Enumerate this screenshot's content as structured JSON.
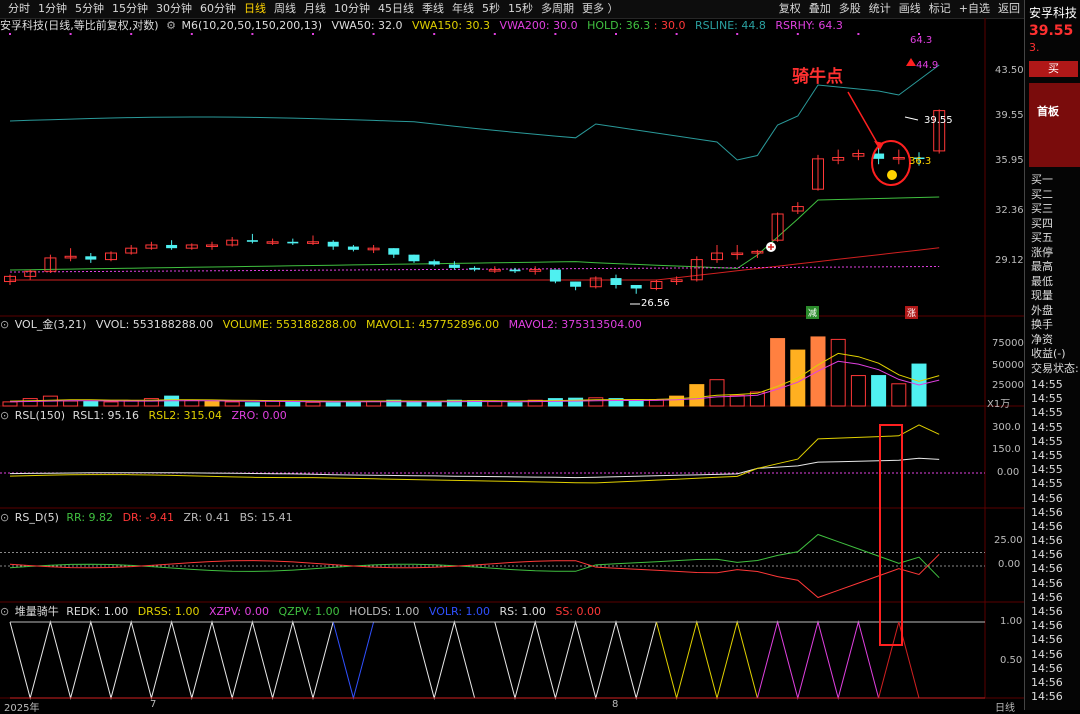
{
  "toolbar": {
    "periods": [
      "分时",
      "1分钟",
      "5分钟",
      "15分钟",
      "30分钟",
      "60分钟",
      "日线",
      "周线",
      "月线",
      "10分钟",
      "45日线",
      "季线",
      "年线",
      "5秒",
      "15秒",
      "多周期",
      "更多 ）"
    ],
    "active_period": "日线",
    "right": [
      "复权",
      "叠加",
      "多股",
      "统计",
      "画线",
      "标记",
      "+自选",
      "返回"
    ]
  },
  "main_title": {
    "stock": "安孚科技(日线,等比前复权,对数)",
    "indicator": "M6(10,20,50,150,200,13)",
    "vwa50": "VWA50: 32.0",
    "vwa150": "VWA150: 30.3",
    "vwa200": "VWA200: 30.0",
    "hold": "HOLD: 36.3",
    "hold2": ": 30.0",
    "rsline": "RSLINE: 44.8",
    "rsrhy": "RSRHY: 64.3"
  },
  "price_axis": [
    "43.50",
    "39.55",
    "35.95",
    "32.36",
    "29.12"
  ],
  "annotations": {
    "riding_bull": "骑牛点",
    "high_label": "39.55",
    "low_label": "26.56",
    "hold_label": "36.3",
    "rsrhy_label": "64.3",
    "rsline_label": "44.9",
    "jian": "减",
    "zhang": "涨"
  },
  "vol_title": {
    "name": "VOL_金(3,21)",
    "vvol": "VVOL: 553188288.00",
    "volume": "VOLUME: 553188288.00",
    "mavol1": "MAVOL1: 457752896.00",
    "mavol2": "MAVOL2: 375313504.00"
  },
  "vol_axis": [
    "75000",
    "50000",
    "25000"
  ],
  "vol_unit": "X1万",
  "rsl_title": {
    "name": "RSL(150)",
    "rsl1": "RSL1: 95.16",
    "rsl2": "RSL2: 315.04",
    "zro": "ZRO: 0.00"
  },
  "rsl_axis": [
    "300.0",
    "150.0",
    "0.00"
  ],
  "rsd_title": {
    "name": "RS_D(5)",
    "rr": "RR: 9.82",
    "dr": "DR: -9.41",
    "zr": "ZR: 0.41",
    "bs": "BS: 15.41"
  },
  "rsd_axis": [
    "25.00",
    "0.00"
  ],
  "bull_title": {
    "name": "堆量骑牛",
    "redk": "REDK: 1.00",
    "drss": "DRSS: 1.00",
    "xzpv": "XZPV: 0.00",
    "qzpv": "QZPV: 1.00",
    "holds": "HOLDS: 1.00",
    "volr": "VOLR: 1.00",
    "rs": "RS: 1.00",
    "ss": "SS: 0.00"
  },
  "bull_axis": [
    "1.00",
    "0.50"
  ],
  "date_axis": [
    "2025年",
    "7",
    "8"
  ],
  "date_corner": "日线",
  "sidebar": {
    "name": "安孚科技",
    "price": "39.55",
    "price_suffix": "3.",
    "buy": "买",
    "board": "首板",
    "rows": [
      "买一",
      "买二",
      "买三",
      "买四",
      "买五",
      "涨停",
      "最高",
      "最低",
      "现量",
      "外盘",
      "换手",
      "净资",
      "收益(-)",
      "交易状态:"
    ],
    "times": [
      "14:55",
      "14:55",
      "14:55",
      "14:55",
      "14:55",
      "14:55",
      "14:55",
      "14:55",
      "14:56",
      "14:56",
      "14:56",
      "14:56",
      "14:56",
      "14:56",
      "14:56",
      "14:56",
      "14:56",
      "14:56",
      "14:56",
      "14:56",
      "14:56",
      "14:56",
      "14:56"
    ]
  },
  "colors": {
    "up": "#ff3838",
    "down": "#4ff0f0",
    "gold": "#ffb020",
    "orange": "#ff8040",
    "vwa150": "#e0d000",
    "magenta": "#e040e0",
    "green": "#40c040",
    "teal": "#2a9a9a"
  },
  "chart_data": {
    "type": "candlestick",
    "candles": [
      [
        27.6,
        27.9,
        27.4,
        28.0
      ],
      [
        27.9,
        28.2,
        27.7,
        28.3
      ],
      [
        28.2,
        29.0,
        28.1,
        29.2
      ],
      [
        29.0,
        29.1,
        28.8,
        29.6
      ],
      [
        29.1,
        28.9,
        28.7,
        29.3
      ],
      [
        28.9,
        29.3,
        28.8,
        29.4
      ],
      [
        29.3,
        29.6,
        29.2,
        29.8
      ],
      [
        29.6,
        29.8,
        29.5,
        30.0
      ],
      [
        29.8,
        29.6,
        29.5,
        30.1
      ],
      [
        29.6,
        29.8,
        29.5,
        29.9
      ],
      [
        29.8,
        29.8,
        29.5,
        30.0
      ],
      [
        29.8,
        30.1,
        29.7,
        30.3
      ],
      [
        30.1,
        30.0,
        29.9,
        30.5
      ],
      [
        30.0,
        30.0,
        29.8,
        30.2
      ],
      [
        30.0,
        29.9,
        29.8,
        30.2
      ],
      [
        29.9,
        30.0,
        29.8,
        30.4
      ],
      [
        30.0,
        29.7,
        29.5,
        30.1
      ],
      [
        29.7,
        29.5,
        29.4,
        29.8
      ],
      [
        29.5,
        29.6,
        29.3,
        29.8
      ],
      [
        29.6,
        29.2,
        29.0,
        29.6
      ],
      [
        29.2,
        28.8,
        28.7,
        29.2
      ],
      [
        28.8,
        28.6,
        28.5,
        28.9
      ],
      [
        28.6,
        28.4,
        28.3,
        28.8
      ],
      [
        28.4,
        28.3,
        28.2,
        28.5
      ],
      [
        28.3,
        28.3,
        28.1,
        28.5
      ],
      [
        28.3,
        28.2,
        28.1,
        28.4
      ],
      [
        28.2,
        28.3,
        28.0,
        28.5
      ],
      [
        28.3,
        27.6,
        27.5,
        28.3
      ],
      [
        27.6,
        27.3,
        27.1,
        27.6
      ],
      [
        27.3,
        27.8,
        27.2,
        27.9
      ],
      [
        27.8,
        27.4,
        27.2,
        28.0
      ],
      [
        27.4,
        27.2,
        26.9,
        27.4
      ],
      [
        27.2,
        27.6,
        27.1,
        27.7
      ],
      [
        27.6,
        27.7,
        27.4,
        27.9
      ],
      [
        27.7,
        28.9,
        27.6,
        29.1
      ],
      [
        28.9,
        29.3,
        28.7,
        29.8
      ],
      [
        29.3,
        29.3,
        28.9,
        29.8
      ],
      [
        29.3,
        29.4,
        29.0,
        29.5
      ],
      [
        30.1,
        31.8,
        30.0,
        31.9
      ],
      [
        32.0,
        32.3,
        31.8,
        32.6
      ],
      [
        33.5,
        35.7,
        33.4,
        36.0
      ],
      [
        35.6,
        35.8,
        35.3,
        36.4
      ],
      [
        35.9,
        36.1,
        35.6,
        36.4
      ],
      [
        36.1,
        35.7,
        35.3,
        36.9
      ],
      [
        35.7,
        35.8,
        35.3,
        36.4
      ],
      [
        35.8,
        35.7,
        35.2,
        36.2
      ],
      [
        36.3,
        39.5,
        36.1,
        39.6
      ]
    ],
    "volume_wan": [
      5000,
      9000,
      12000,
      6000,
      5500,
      5000,
      6000,
      9000,
      12000,
      7000,
      6000,
      5000,
      4000,
      6000,
      5000,
      4500,
      4000,
      5500,
      6000,
      7000,
      5000,
      5500,
      7000,
      6500,
      5500,
      4000,
      7000,
      9000,
      9500,
      10000,
      9000,
      7000,
      7500,
      12000,
      26000,
      32000,
      13000,
      17000,
      82000,
      68000,
      84000,
      81000,
      37000,
      37000,
      27000,
      51000
    ],
    "mavol_wan": [
      6000,
      6500,
      7000,
      7500,
      7500,
      7200,
      7000,
      7000,
      7500,
      7600,
      7400,
      7000,
      6800,
      6600,
      6400,
      6200,
      6000,
      6000,
      6100,
      6200,
      6100,
      6000,
      6200,
      6400,
      6300,
      6100,
      6300,
      6600,
      7000,
      7500,
      7800,
      7900,
      8000,
      8800,
      10500,
      13000,
      14000,
      15500,
      24000,
      34000,
      50000,
      64000,
      60000,
      52000,
      38000,
      30000,
      37000
    ],
    "ylim_price": [
      26.0,
      46.0
    ],
    "ylim_volume_wan": [
      0,
      90000
    ]
  }
}
